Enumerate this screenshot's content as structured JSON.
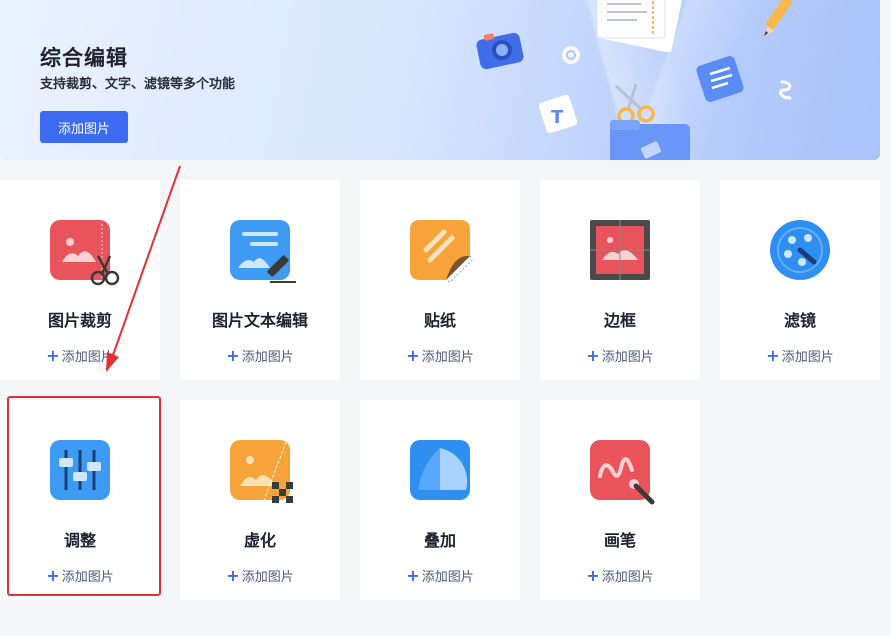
{
  "banner": {
    "title": "综合编辑",
    "subtitle": "支持裁剪、文字、滤镜等多个功能",
    "button_label": "添加图片"
  },
  "cards": [
    {
      "title": "图片裁剪",
      "add_label": "添加图片",
      "icon": "crop-image-icon"
    },
    {
      "title": "图片文本编辑",
      "add_label": "添加图片",
      "icon": "text-edit-icon"
    },
    {
      "title": "贴纸",
      "add_label": "添加图片",
      "icon": "sticker-icon"
    },
    {
      "title": "边框",
      "add_label": "添加图片",
      "icon": "frame-icon"
    },
    {
      "title": "滤镜",
      "add_label": "添加图片",
      "icon": "filter-icon"
    },
    {
      "title": "调整",
      "add_label": "添加图片",
      "icon": "adjust-sliders-icon"
    },
    {
      "title": "虚化",
      "add_label": "添加图片",
      "icon": "blur-icon"
    },
    {
      "title": "叠加",
      "add_label": "添加图片",
      "icon": "overlay-icon"
    },
    {
      "title": "画笔",
      "add_label": "添加图片",
      "icon": "brush-icon"
    }
  ],
  "plus_symbol": "+",
  "colors": {
    "accent": "#3c6af1",
    "highlight": "#e03030"
  }
}
